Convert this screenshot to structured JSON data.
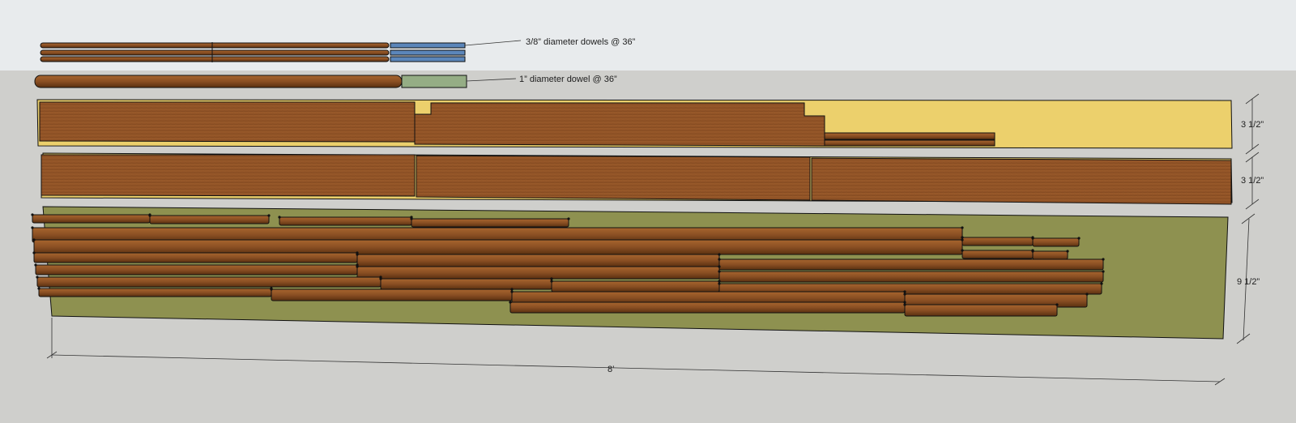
{
  "labels": {
    "small_dowels": "3/8” diameter dowels @ 36”",
    "large_dowel": "1” diameter dowel @ 36”",
    "board_width_1": "3 1/2”",
    "board_width_2": "3 1/2”",
    "plank_width": "9 1/2”",
    "length": "8’"
  },
  "colors": {
    "sky": "#e8ebed",
    "ground": "#cfcfcc",
    "wood": "#8a4f23",
    "wood_light": "#a8652e",
    "wood_dark": "#5a3010",
    "small_dowel_end": "#5b86ba",
    "large_dowel_end": "#95ad85",
    "yellow_stock": "#ecd06c",
    "olive_stock": "#8e9150",
    "outline": "#111111"
  }
}
